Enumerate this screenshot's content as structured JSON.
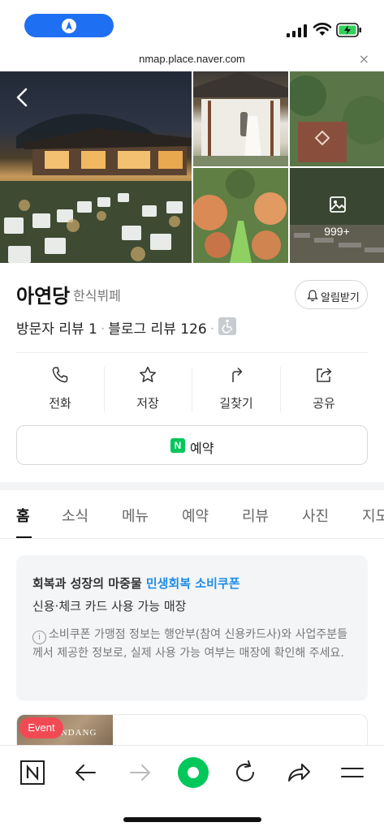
{
  "status_bar": {
    "icons": [
      "location-arrow-icon",
      "signal-icon",
      "wifi-icon",
      "battery-charging-icon"
    ]
  },
  "browser": {
    "url": "nmap.place.naver.com",
    "close_label": "×"
  },
  "photos": {
    "more_count": "999+"
  },
  "place": {
    "name": "아연당",
    "category": "한식뷔페",
    "visitor_reviews": "방문자 리뷰 1",
    "separator": "·",
    "blog_reviews": "블로그 리뷰 126",
    "alarm_label": "알림받기"
  },
  "actions": [
    {
      "label": "전화",
      "icon": "phone-icon"
    },
    {
      "label": "저장",
      "icon": "star-icon"
    },
    {
      "label": "길찾기",
      "icon": "directions-icon"
    },
    {
      "label": "공유",
      "icon": "share-icon"
    }
  ],
  "reserve": {
    "badge": "N",
    "label": "예약"
  },
  "tabs": [
    "홈",
    "소식",
    "메뉴",
    "예약",
    "리뷰",
    "사진",
    "지도"
  ],
  "notice": {
    "title_prefix": "회복과 성장의 마중물 ",
    "title_highlight": "민생회복 소비쿠폰",
    "subtitle": "신용·체크 카드 사용 가능 매장",
    "info_icon": "i",
    "body": "소비쿠폰 가맹점 정보는 행안부(참여 신용카드사)와 사업주분들께서 제공한 정보로, 실제 사용 가능 여부는 매장에 확인해 주세요."
  },
  "event": {
    "badge": "Event",
    "brand": "ENDANG"
  },
  "colors": {
    "accent_blue": "#1f8ce6",
    "naver_green": "#03c75a",
    "event_red": "#f24a55",
    "status_blue": "#1f6ff2"
  }
}
